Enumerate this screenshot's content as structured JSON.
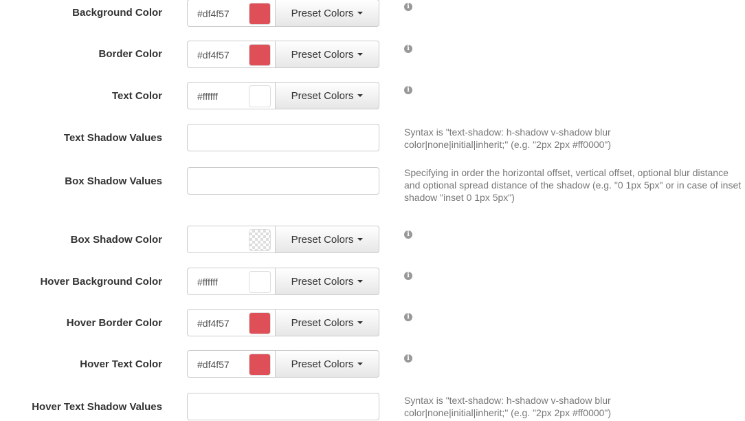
{
  "preset_label": "Preset Colors",
  "info_glyph": "i",
  "rows": [
    {
      "label": "Background Color",
      "hex": "#df4f57",
      "swatch": "#df4f57"
    },
    {
      "label": "Border Color",
      "hex": "#df4f57",
      "swatch": "#df4f57"
    },
    {
      "label": "Text Color",
      "hex": "#ffffff",
      "swatch": "#ffffff"
    },
    {
      "label": "Text Shadow Values",
      "help": "Syntax is \"text-shadow: h-shadow v-shadow blur color|none|initial|inherit;\" (e.g. \"2px 2px #ff0000\")"
    },
    {
      "label": "Box Shadow Values",
      "help": "Specifying in order the horizontal offset, vertical offset, optional blur distance and optional spread distance of the shadow (e.g. \"0 1px 5px\" or in case of inset shadow \"inset 0 1px 5px\")"
    },
    {
      "label": "Box Shadow Color",
      "hex": "",
      "swatch": "transparent"
    },
    {
      "label": "Hover Background Color",
      "hex": "#ffffff",
      "swatch": "#ffffff"
    },
    {
      "label": "Hover Border Color",
      "hex": "#df4f57",
      "swatch": "#df4f57"
    },
    {
      "label": "Hover Text Color",
      "hex": "#df4f57",
      "swatch": "#df4f57"
    },
    {
      "label": "Hover Text Shadow Values",
      "help": "Syntax is \"text-shadow: h-shadow v-shadow blur color|none|initial|inherit;\" (e.g. \"2px 2px #ff0000\")"
    }
  ]
}
